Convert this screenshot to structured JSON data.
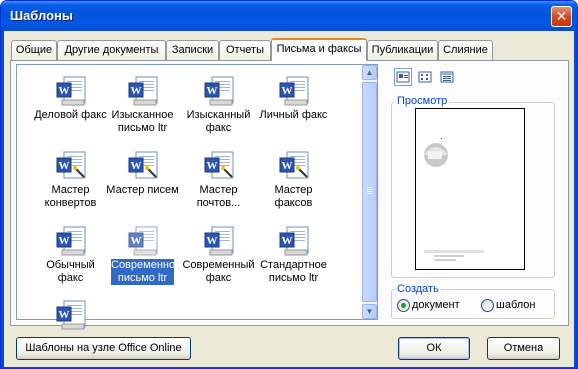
{
  "window": {
    "title": "Шаблоны"
  },
  "tabs": [
    {
      "label": "Общие"
    },
    {
      "label": "Другие документы"
    },
    {
      "label": "Записки"
    },
    {
      "label": "Отчеты"
    },
    {
      "label": "Письма и факсы",
      "active": true
    },
    {
      "label": "Публикации"
    },
    {
      "label": "Слияние"
    }
  ],
  "templates": [
    {
      "label": "Деловой факс",
      "icon": "word-fax-icon"
    },
    {
      "label": "Изысканное письмо ltr",
      "icon": "word-letter-icon"
    },
    {
      "label": "Изысканный факс",
      "icon": "word-fax-icon"
    },
    {
      "label": "Личный факс",
      "icon": "word-fax-icon"
    },
    {
      "label": "Мастер конвертов",
      "icon": "word-wizard-icon"
    },
    {
      "label": "Мастер писем",
      "icon": "word-wizard-icon"
    },
    {
      "label": "Мастер почтов...",
      "icon": "word-wizard-icon"
    },
    {
      "label": "Мастер факсов",
      "icon": "word-wizard-icon"
    },
    {
      "label": "Обычный факс",
      "icon": "word-fax-icon"
    },
    {
      "label": "Современное письмо ltr",
      "icon": "word-letter-icon",
      "selected": true
    },
    {
      "label": "Современный факс",
      "icon": "word-fax-icon"
    },
    {
      "label": "Стандартное письмо ltr",
      "icon": "word-letter-icon"
    },
    {
      "label": "",
      "icon": "word-letter-icon"
    }
  ],
  "preview": {
    "label": "Просмотр"
  },
  "create": {
    "label": "Создать",
    "options": [
      {
        "label": "документ",
        "selected": true
      },
      {
        "label": "шаблон",
        "selected": false
      }
    ]
  },
  "buttons": {
    "office_online": "Шаблоны на узле Office Online",
    "ok": "ОК",
    "cancel": "Отмена"
  },
  "colors": {
    "titlebar": "#0553dc",
    "selection": "#316ac5",
    "active_tab_accent": "#e68b2c"
  }
}
